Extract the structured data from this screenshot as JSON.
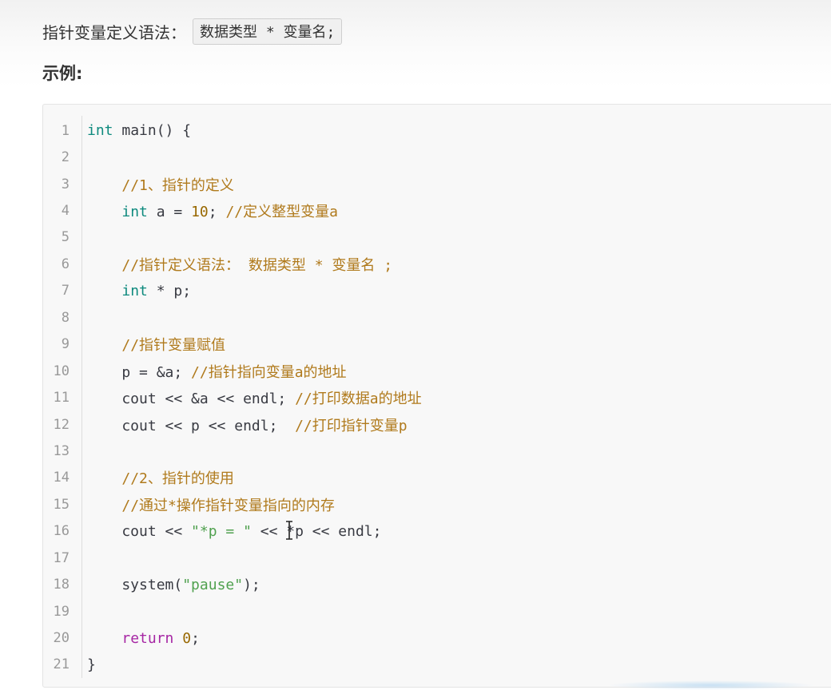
{
  "header": {
    "syntax_label": "指针变量定义语法：",
    "syntax_code": "数据类型 * 变量名;",
    "example_label": "示例:"
  },
  "code": {
    "lines": [
      {
        "n": "1",
        "parts": [
          {
            "t": "int",
            "c": "kw"
          },
          {
            "t": " main() {",
            "c": "plain"
          }
        ]
      },
      {
        "n": "2",
        "parts": []
      },
      {
        "n": "3",
        "parts": [
          {
            "t": "    ",
            "c": "plain"
          },
          {
            "t": "//1、指针的定义",
            "c": "cmt"
          }
        ]
      },
      {
        "n": "4",
        "parts": [
          {
            "t": "    ",
            "c": "plain"
          },
          {
            "t": "int",
            "c": "kw"
          },
          {
            "t": " a = ",
            "c": "plain"
          },
          {
            "t": "10",
            "c": "num"
          },
          {
            "t": "; ",
            "c": "plain"
          },
          {
            "t": "//定义整型变量a",
            "c": "cmt"
          }
        ]
      },
      {
        "n": "5",
        "parts": []
      },
      {
        "n": "6",
        "parts": [
          {
            "t": "    ",
            "c": "plain"
          },
          {
            "t": "//指针定义语法： 数据类型 * 变量名 ;",
            "c": "cmt"
          }
        ]
      },
      {
        "n": "7",
        "parts": [
          {
            "t": "    ",
            "c": "plain"
          },
          {
            "t": "int",
            "c": "kw"
          },
          {
            "t": " * p;",
            "c": "plain"
          }
        ]
      },
      {
        "n": "8",
        "parts": []
      },
      {
        "n": "9",
        "parts": [
          {
            "t": "    ",
            "c": "plain"
          },
          {
            "t": "//指针变量赋值",
            "c": "cmt"
          }
        ]
      },
      {
        "n": "10",
        "parts": [
          {
            "t": "    p = &a; ",
            "c": "plain"
          },
          {
            "t": "//指针指向变量a的地址",
            "c": "cmt"
          }
        ]
      },
      {
        "n": "11",
        "parts": [
          {
            "t": "    cout << &a << endl; ",
            "c": "plain"
          },
          {
            "t": "//打印数据a的地址",
            "c": "cmt"
          }
        ]
      },
      {
        "n": "12",
        "parts": [
          {
            "t": "    cout << p << endl;  ",
            "c": "plain"
          },
          {
            "t": "//打印指针变量p",
            "c": "cmt"
          }
        ]
      },
      {
        "n": "13",
        "parts": []
      },
      {
        "n": "14",
        "parts": [
          {
            "t": "    ",
            "c": "plain"
          },
          {
            "t": "//2、指针的使用",
            "c": "cmt"
          }
        ]
      },
      {
        "n": "15",
        "parts": [
          {
            "t": "    ",
            "c": "plain"
          },
          {
            "t": "//通过*操作指针变量指向的内存",
            "c": "cmt"
          }
        ]
      },
      {
        "n": "16",
        "parts": [
          {
            "t": "    cout << ",
            "c": "plain"
          },
          {
            "t": "\"*p = \"",
            "c": "str"
          },
          {
            "t": " << *p << endl;",
            "c": "plain"
          }
        ]
      },
      {
        "n": "17",
        "parts": []
      },
      {
        "n": "18",
        "parts": [
          {
            "t": "    system(",
            "c": "plain"
          },
          {
            "t": "\"pause\"",
            "c": "str"
          },
          {
            "t": ");",
            "c": "plain"
          }
        ]
      },
      {
        "n": "19",
        "parts": []
      },
      {
        "n": "20",
        "parts": [
          {
            "t": "    ",
            "c": "plain"
          },
          {
            "t": "return",
            "c": "ret"
          },
          {
            "t": " ",
            "c": "plain"
          },
          {
            "t": "0",
            "c": "num"
          },
          {
            "t": ";",
            "c": "plain"
          }
        ]
      },
      {
        "n": "21",
        "parts": [
          {
            "t": "}",
            "c": "plain"
          }
        ]
      }
    ]
  },
  "icons": {
    "cursor": "text-cursor-icon"
  }
}
